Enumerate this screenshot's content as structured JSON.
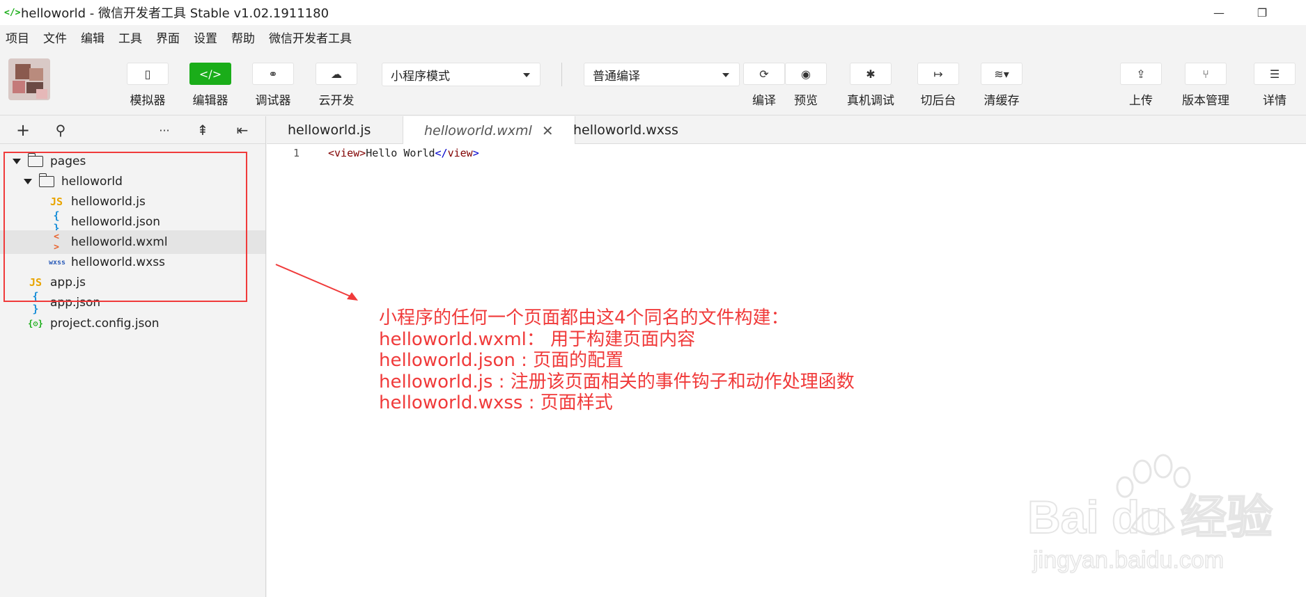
{
  "window": {
    "title": "helloworld - 微信开发者工具 Stable v1.02.1911180",
    "logo": "</>",
    "minimize": "—",
    "restore": "❐"
  },
  "menu": [
    "项目",
    "文件",
    "编辑",
    "工具",
    "界面",
    "设置",
    "帮助",
    "微信开发者工具"
  ],
  "toolbar": {
    "left_tools": [
      {
        "label": "模拟器",
        "icon": "phone-icon",
        "glyph": "▯"
      },
      {
        "label": "编辑器",
        "icon": "code-icon",
        "glyph": "</>"
      },
      {
        "label": "调试器",
        "icon": "debugger-icon",
        "glyph": "⚭"
      },
      {
        "label": "云开发",
        "icon": "cloud-dev-icon",
        "glyph": "☁"
      }
    ],
    "mode_select": "小程序模式",
    "compile_select": "普通编译",
    "right_tools": [
      {
        "label": "编译",
        "icon": "refresh-icon",
        "glyph": "⟳"
      },
      {
        "label": "预览",
        "icon": "eye-icon",
        "glyph": "◉"
      },
      {
        "label": "真机调试",
        "icon": "bug-icon",
        "glyph": "✱"
      },
      {
        "label": "切后台",
        "icon": "switch-icon",
        "glyph": "↦"
      },
      {
        "label": "清缓存",
        "icon": "layers-icon",
        "glyph": "≋▾"
      },
      {
        "label": "上传",
        "icon": "upload-icon",
        "glyph": "⇪"
      },
      {
        "label": "版本管理",
        "icon": "branch-icon",
        "glyph": "⑂"
      },
      {
        "label": "详情",
        "icon": "menu-icon",
        "glyph": "☰"
      }
    ]
  },
  "sidebar": {
    "tools": [
      {
        "name": "add-icon",
        "glyph": "+"
      },
      {
        "name": "search-icon",
        "glyph": "⚲"
      },
      {
        "name": "more-icon",
        "glyph": "···"
      },
      {
        "name": "collapse-icon",
        "glyph": "⇞"
      },
      {
        "name": "layout-icon",
        "glyph": "⇤"
      }
    ],
    "tree": [
      {
        "label": "pages",
        "type": "folder",
        "indent": 0
      },
      {
        "label": "helloworld",
        "type": "folder",
        "indent": 1
      },
      {
        "label": "helloworld.js",
        "type": "js",
        "icon": "JS",
        "indent": 2
      },
      {
        "label": "helloworld.json",
        "type": "json",
        "icon": "{ }",
        "indent": 2
      },
      {
        "label": "helloworld.wxml",
        "type": "wxml",
        "icon": "< >",
        "indent": 2,
        "selected": true
      },
      {
        "label": "helloworld.wxss",
        "type": "wxss",
        "icon": "wxss",
        "indent": 2
      },
      {
        "label": "app.js",
        "type": "js",
        "icon": "JS",
        "indent": 1
      },
      {
        "label": "app.json",
        "type": "json",
        "icon": "{ }",
        "indent": 1
      },
      {
        "label": "project.config.json",
        "type": "proj",
        "icon": "{⚙}",
        "indent": 1
      }
    ]
  },
  "tabs": [
    {
      "label": "helloworld.js"
    },
    {
      "label": "helloworld.wxml",
      "active": true,
      "close": "✕"
    },
    {
      "label": "helloworld.wxss"
    }
  ],
  "editor": {
    "line_number": "1",
    "code_open": "<view>",
    "code_text": "Hello World",
    "code_close_lt": "</",
    "code_close_tag": "view",
    "code_close_gt": ">"
  },
  "annotation": {
    "lines": [
      "小程序的任何一个页面都由这4个同名的文件构建：",
      "helloworld.wxml：  用于构建页面内容",
      "helloworld.json : 页面的配置",
      "helloworld.js : 注册该页面相关的事件钩子和动作处理函数",
      "helloworld.wxss : 页面样式"
    ],
    "color": "#f03a3a"
  },
  "watermark": {
    "brand": "Bai du 经验",
    "url": "jingyan.baidu.com"
  },
  "colors": {
    "accent": "#1aad19",
    "annotation": "#f03a3a"
  }
}
